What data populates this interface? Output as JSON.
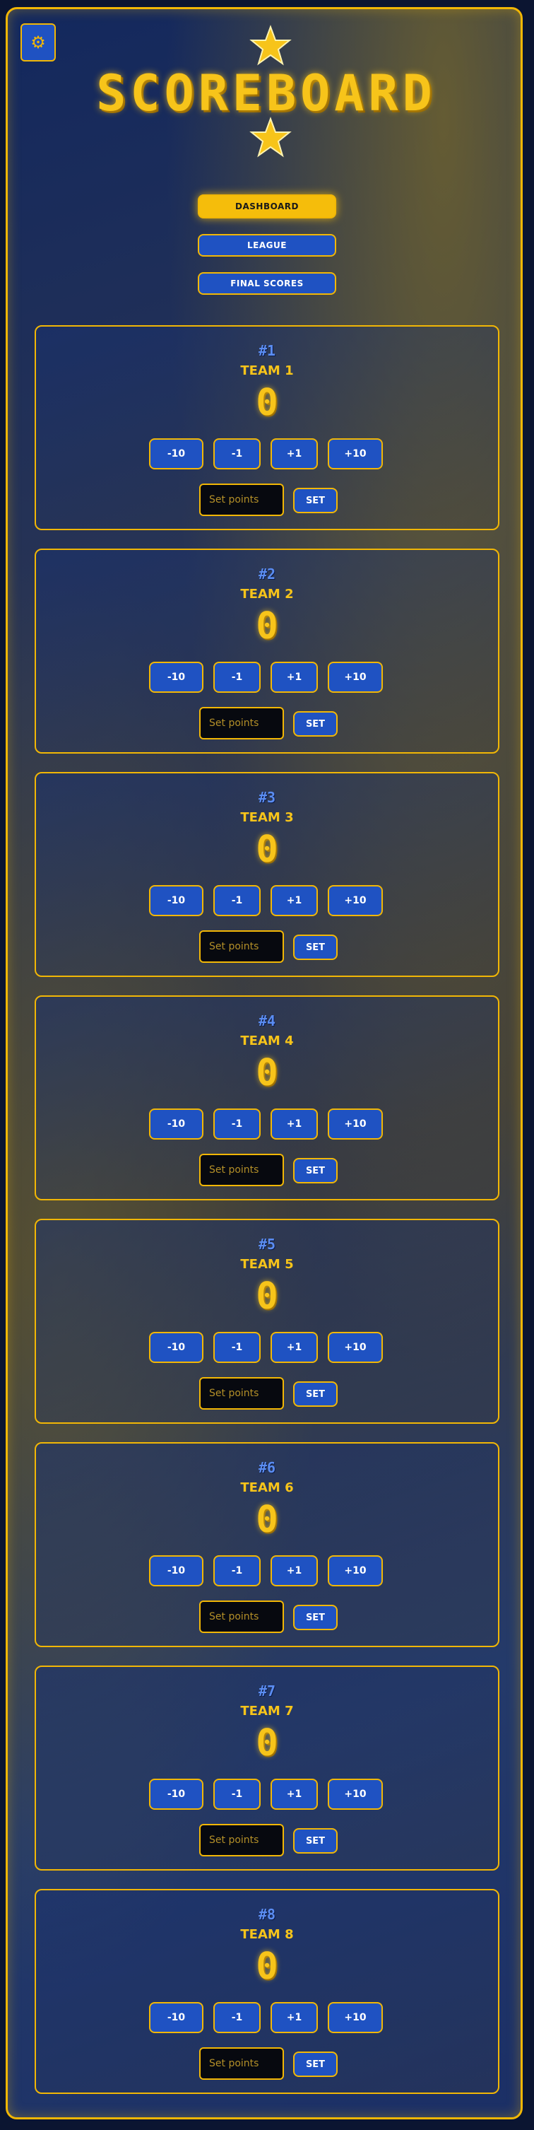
{
  "header": {
    "title": "SCOREBOARD",
    "settings_icon": "gear-icon",
    "star_icon": "star-icon"
  },
  "nav": {
    "dashboard": "DASHBOARD",
    "league": "LEAGUE",
    "final_scores": "FINAL SCORES",
    "active": "dashboard"
  },
  "teams": [
    {
      "rank": "#1",
      "name": "TEAM 1",
      "score": "0"
    },
    {
      "rank": "#2",
      "name": "TEAM 2",
      "score": "0"
    },
    {
      "rank": "#3",
      "name": "TEAM 3",
      "score": "0"
    },
    {
      "rank": "#4",
      "name": "TEAM 4",
      "score": "0"
    },
    {
      "rank": "#5",
      "name": "TEAM 5",
      "score": "0"
    },
    {
      "rank": "#6",
      "name": "TEAM 6",
      "score": "0"
    },
    {
      "rank": "#7",
      "name": "TEAM 7",
      "score": "0"
    },
    {
      "rank": "#8",
      "name": "TEAM 8",
      "score": "0"
    }
  ],
  "controls": {
    "minus10": "-10",
    "minus1": "-1",
    "plus1": "+1",
    "plus10": "+10",
    "set_placeholder": "Set points",
    "set_label": "SET"
  },
  "colors": {
    "accent": "#f2b705",
    "button_blue": "#1f52c2",
    "rank_blue": "#5b8df2",
    "background": "#0b1531"
  }
}
